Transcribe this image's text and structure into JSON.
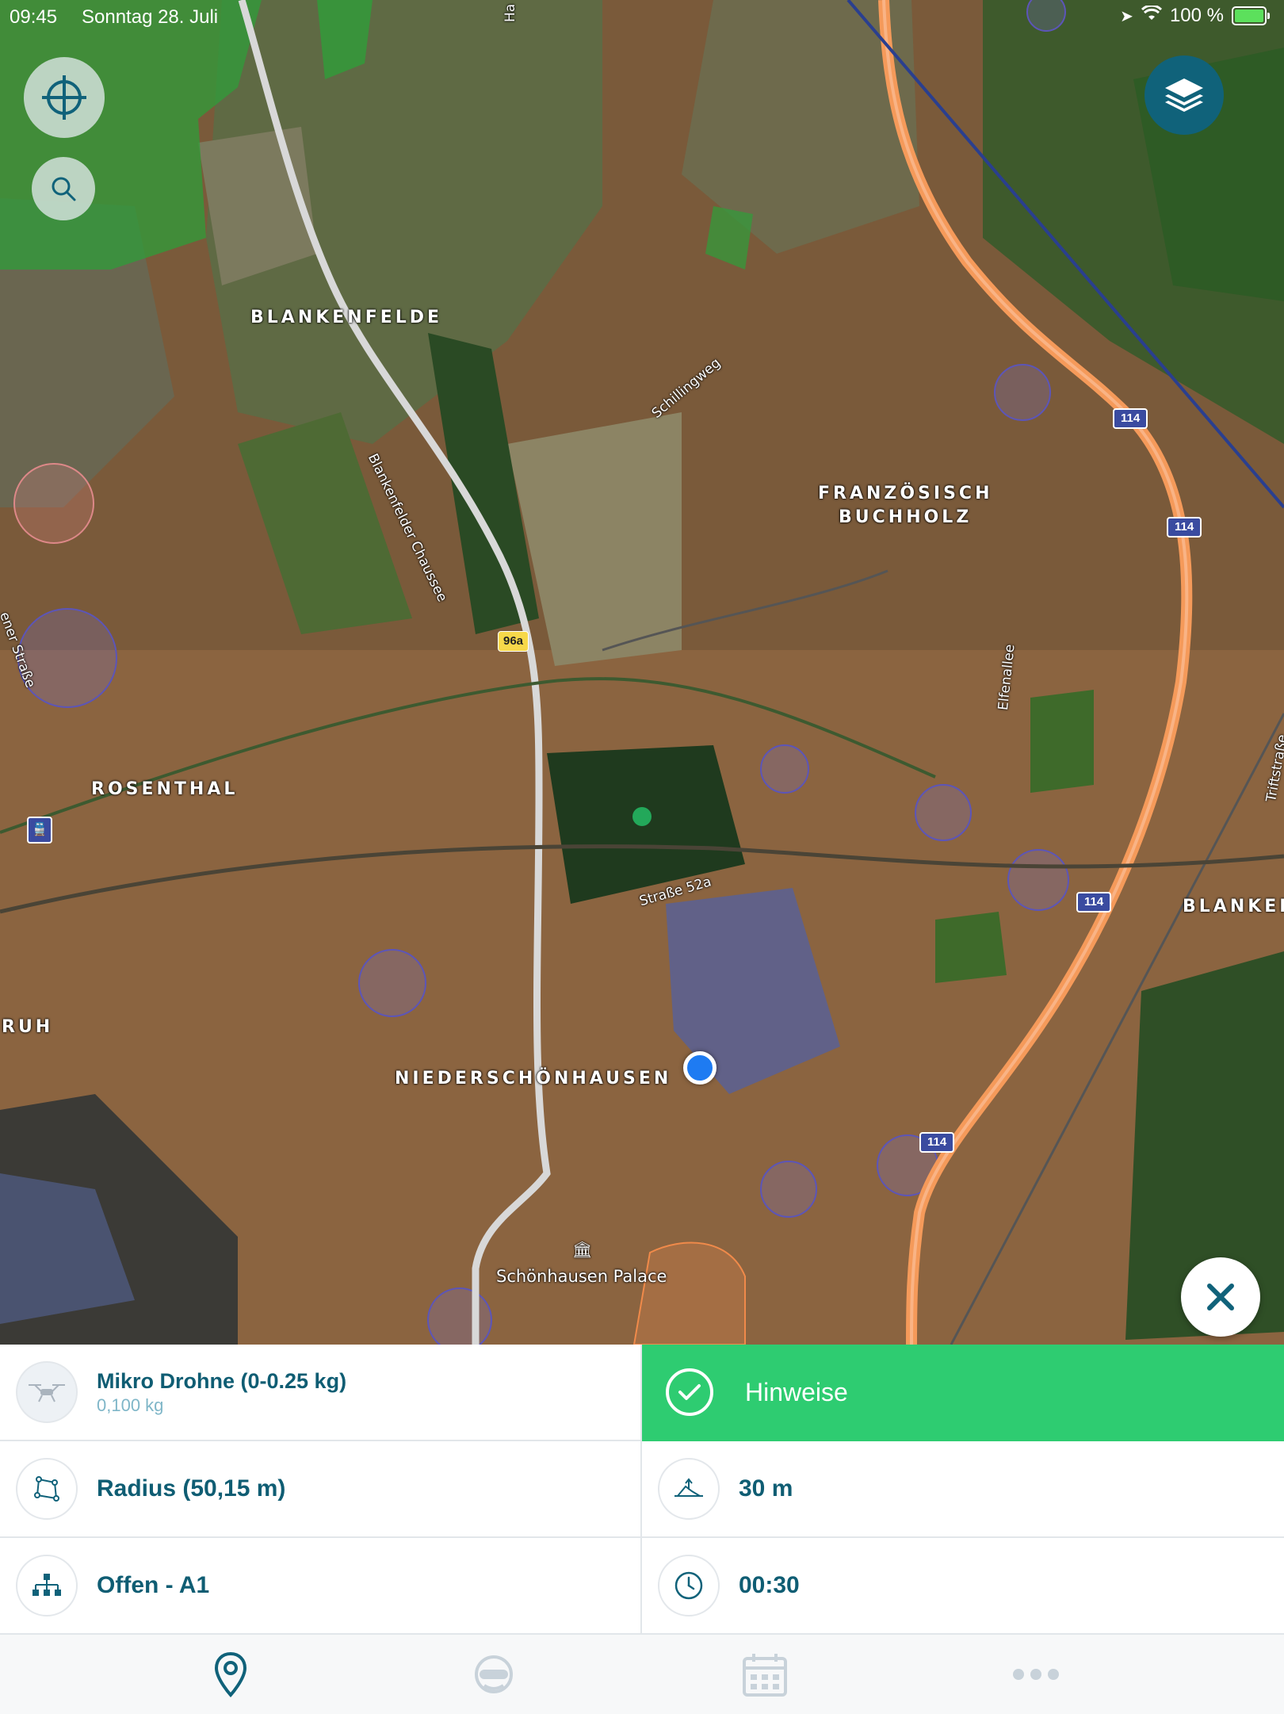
{
  "status_bar": {
    "time": "09:45",
    "date": "Sonntag 28. Juli",
    "battery": "100 %"
  },
  "map": {
    "place_labels": [
      "BLANKENFELDE",
      "FRANZÖSISCH",
      "BUCHHOLZ",
      "ROSENTHAL",
      "NIEDERSCHÖNHAUSEN",
      "RUH",
      "BLANKEN"
    ],
    "street_labels": [
      "Blankenfelder Chaussee",
      "Schillingweg",
      "Straße 52a",
      "Elfenallee",
      "Triftstraße",
      "Ha",
      "ener Straße"
    ],
    "poi_label": "Schönhausen Palace",
    "highway_shields": [
      "114",
      "114",
      "114",
      "114"
    ],
    "road_shield": "96a",
    "icons": {
      "locate": "crosshair-icon",
      "search": "search-icon",
      "layers": "layers-icon",
      "close": "close-icon"
    }
  },
  "panel": {
    "drone": {
      "title": "Mikro Drohne (0-0.25 kg)",
      "weight": "0,100 kg"
    },
    "hinweise": {
      "label": "Hinweise"
    },
    "radius": {
      "label": "Radius (50,15 m)"
    },
    "altitude": {
      "label": "30 m"
    },
    "category": {
      "label": "Offen - A1"
    },
    "duration": {
      "label": "00:30"
    }
  },
  "tabs": [
    "map-pin-icon",
    "pilot-icon",
    "calendar-icon",
    "more-icon"
  ],
  "colors": {
    "accent": "#10627a",
    "text": "#0f5d73",
    "success": "#2ecc71",
    "location": "#1e7bf2",
    "highway": "#f59a5a"
  }
}
